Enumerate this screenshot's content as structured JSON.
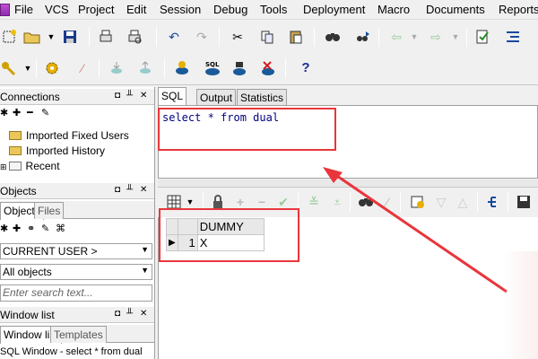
{
  "menu": [
    "File",
    "VCS",
    "Project",
    "Edit",
    "Session",
    "Debug",
    "Tools",
    "Deployment",
    "Macro",
    "Documents",
    "Reports"
  ],
  "toolbar1_icons": [
    "new-window-icon",
    "open-folder-icon",
    "save-icon",
    "print-icon",
    "print-preview-icon",
    "undo-icon",
    "redo-icon",
    "cut-icon",
    "copy-icon",
    "paste-icon",
    "find-icon",
    "find-next-icon",
    "import-icon",
    "export-icon",
    "compile-icon",
    "format-icon"
  ],
  "toolbar2_icons": [
    "key-icon",
    "execute-gear-icon",
    "break-icon",
    "commit-icon",
    "rollback-icon",
    "database-icon",
    "sql-icon",
    "explain-icon",
    "disconnect-icon",
    "help-icon"
  ],
  "toolbar2_help_label": "?",
  "connections": {
    "title": "Connections",
    "items": [
      "Imported Fixed Users",
      "Imported History",
      "Recent"
    ]
  },
  "objects": {
    "title": "Objects",
    "tabs": [
      "Objects",
      "Files"
    ],
    "user_combo": "CURRENT USER >",
    "filter_combo": "All objects",
    "search_placeholder": "Enter search text..."
  },
  "window_list": {
    "title": "Window list",
    "tabs": [
      "Window list",
      "Templates"
    ],
    "item": "SQL Window - select * from dual"
  },
  "editor": {
    "tabs": [
      "SQL",
      "Output",
      "Statistics"
    ],
    "sql": "select * from dual"
  },
  "results": {
    "columns": [
      "DUMMY"
    ],
    "rows": [
      {
        "num": "1",
        "values": [
          "X"
        ]
      }
    ]
  },
  "annotation_color": "#e8363c"
}
